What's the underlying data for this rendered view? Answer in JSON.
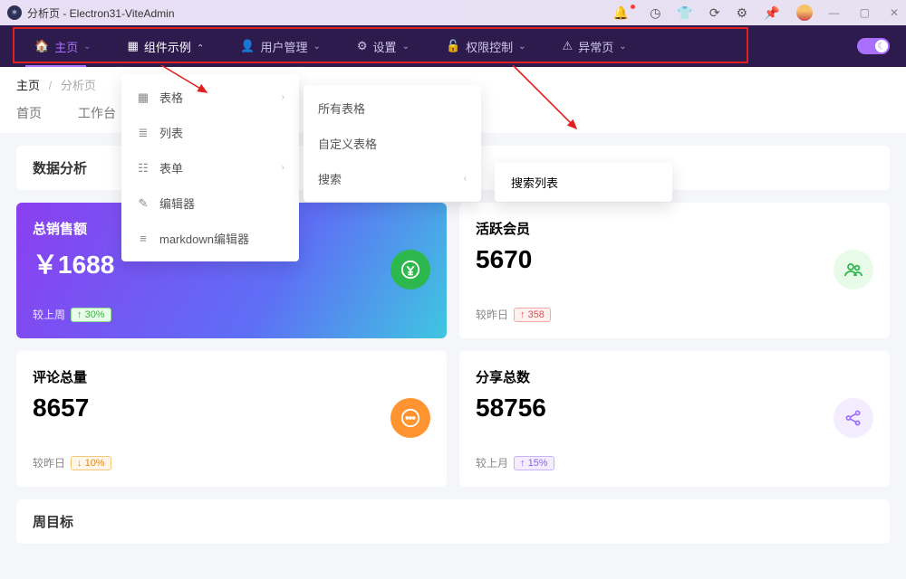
{
  "window": {
    "title": "分析页 - Electron31-ViteAdmin"
  },
  "titlebar_icons": [
    "bell",
    "clock",
    "shirt",
    "refresh",
    "gear",
    "pin"
  ],
  "nav": [
    {
      "icon": "home",
      "label": "主页",
      "state": "active"
    },
    {
      "icon": "grid",
      "label": "组件示例",
      "state": "open"
    },
    {
      "icon": "user",
      "label": "用户管理",
      "state": ""
    },
    {
      "icon": "gear",
      "label": "设置",
      "state": ""
    },
    {
      "icon": "lock",
      "label": "权限控制",
      "state": ""
    },
    {
      "icon": "warn",
      "label": "异常页",
      "state": ""
    }
  ],
  "breadcrumb": {
    "root": "主页",
    "current": "分析页"
  },
  "tabs": [
    "首页",
    "工作台"
  ],
  "section_title": "数据分析",
  "weekly_title": "周目标",
  "menu1": [
    {
      "icon": "▦",
      "label": "表格",
      "sub": true
    },
    {
      "icon": "≣",
      "label": "列表",
      "sub": false
    },
    {
      "icon": "☷",
      "label": "表单",
      "sub": true
    },
    {
      "icon": "✎",
      "label": "编辑器",
      "sub": false
    },
    {
      "icon": "≡",
      "label": "markdown编辑器",
      "sub": false
    }
  ],
  "menu2": [
    {
      "label": "所有表格"
    },
    {
      "label": "自定义表格"
    },
    {
      "label": "搜索",
      "sub": true
    }
  ],
  "submenu_floating": "搜索列表",
  "cards": [
    {
      "label": "总销售额",
      "value": "￥1688",
      "compare_label": "较上周",
      "delta": "↑ 30%",
      "delta_style": "up-green",
      "icon_style": "ic-solid-green",
      "icon": "¥",
      "grad": true
    },
    {
      "label": "活跃会员",
      "value": "5670",
      "compare_label": "较昨日",
      "delta": "↑ 358",
      "delta_style": "up-red",
      "icon_style": "ic-green",
      "icon": "👥",
      "grad": false
    },
    {
      "label": "评论总量",
      "value": "8657",
      "compare_label": "较昨日",
      "delta": "↓ 10%",
      "delta_style": "down-orange",
      "icon_style": "ic-solid-orange",
      "icon": "💬",
      "grad": false
    },
    {
      "label": "分享总数",
      "value": "58756",
      "compare_label": "较上月",
      "delta": "↑ 15%",
      "delta_style": "up-purple",
      "icon_style": "ic-purple",
      "icon": "share",
      "grad": false
    }
  ]
}
